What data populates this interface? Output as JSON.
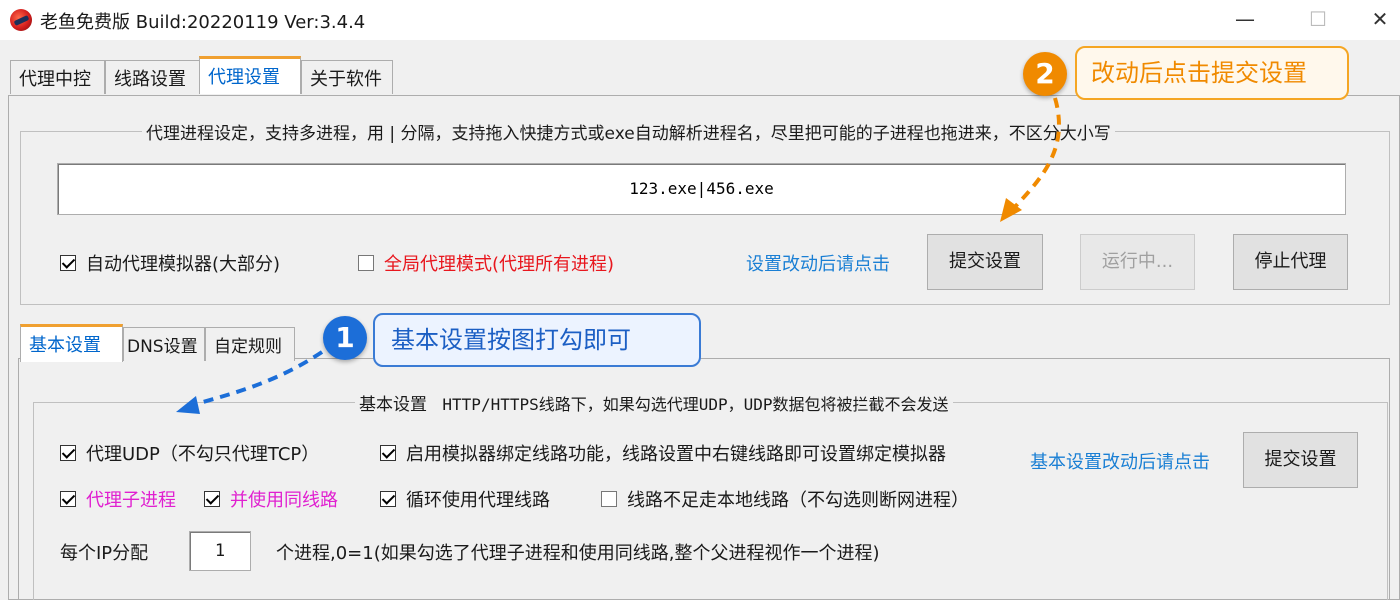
{
  "window": {
    "title": "老鱼免费版 Build:20220119 Ver:3.4.4",
    "minimize_glyph": "—",
    "maximize_glyph": "☐",
    "close_glyph": "✕"
  },
  "top_tabs": [
    "代理中控",
    "线路设置",
    "代理设置",
    "关于软件"
  ],
  "active_top_tab": "代理设置",
  "proxy_process": {
    "group_title": "代理进程设定，支持多进程，用 | 分隔，支持拖入快捷方式或exe自动解析进程名，尽里把可能的子进程也拖进来，不区分大小写",
    "input_value": "123.exe|456.exe",
    "auto_emulator_label": "自动代理模拟器(大部分)",
    "auto_emulator_checked": true,
    "global_mode_label": "全局代理模式(代理所有进程)",
    "global_mode_checked": false,
    "hint_link": "设置改动后请点击",
    "submit_label": "提交设置",
    "running_label": "运行中...",
    "stop_label": "停止代理"
  },
  "inner_tabs": [
    "基本设置",
    "DNS设置",
    "自定规则"
  ],
  "active_inner_tab": "基本设置",
  "basic": {
    "group_title_a": "基本设置",
    "group_title_b": "HTTP/HTTPS线路下，如果勾选代理UDP，UDP数据包将被拦截不会发送",
    "proxy_udp_label": "代理UDP（不勾只代理TCP）",
    "proxy_udp_checked": true,
    "bind_emulator_label": "启用模拟器绑定线路功能，线路设置中右键线路即可设置绑定模拟器",
    "bind_emulator_checked": true,
    "hint_link": "基本设置改动后请点击",
    "submit_label": "提交设置",
    "child_proc_label": "代理子进程",
    "child_proc_checked": true,
    "same_line_label": "并使用同线路",
    "same_line_checked": true,
    "loop_label": "循环使用代理线路",
    "loop_checked": true,
    "local_fallback_label": "线路不足走本地线路（不勾选则断网进程）",
    "local_fallback_checked": false,
    "per_ip_label": "每个IP分配",
    "per_ip_value": "1",
    "per_ip_suffix": "个进程,0=1(如果勾选了代理子进程和使用同线路,整个父进程视作一个进程)"
  },
  "callouts": {
    "one_number": "1",
    "one_text": "基本设置按图打勾即可",
    "two_number": "2",
    "two_text": "改动后点击提交设置"
  },
  "colors": {
    "accent_blue": "#1a7fd4",
    "red_text": "#e8161d",
    "magenta_text": "#e020d0",
    "callout_orange": "#f08a00",
    "callout_blue": "#1c6ed8"
  }
}
